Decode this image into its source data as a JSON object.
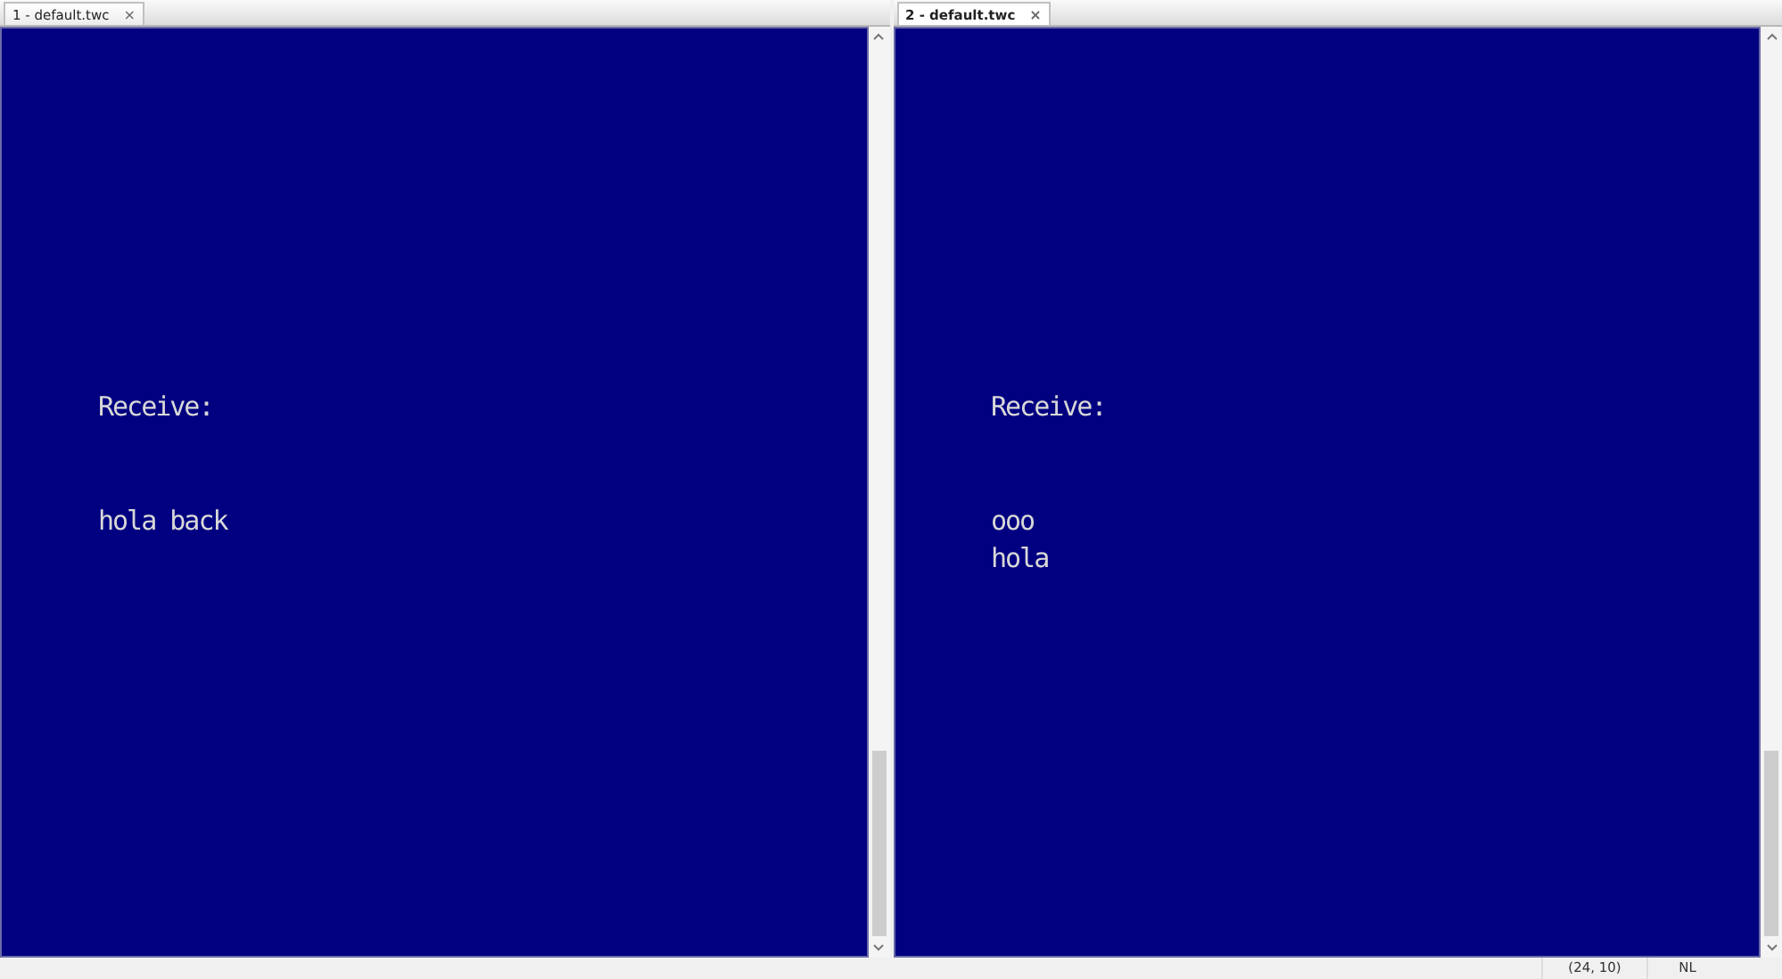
{
  "panes": [
    {
      "tab": {
        "label": "1 - default.twc",
        "close": "×",
        "selected": false
      },
      "blocks": [
        {
          "lines": [
            "Receive:"
          ]
        },
        {
          "lines": [
            "hola back"
          ]
        }
      ]
    },
    {
      "tab": {
        "label": "2 - default.twc",
        "close": "×",
        "selected": true
      },
      "blocks": [
        {
          "lines": [
            "Receive:"
          ]
        },
        {
          "lines": [
            "ooo",
            "hola"
          ]
        }
      ]
    }
  ],
  "status_bar": {
    "position": "(24, 10)",
    "line_ending": "NL"
  }
}
